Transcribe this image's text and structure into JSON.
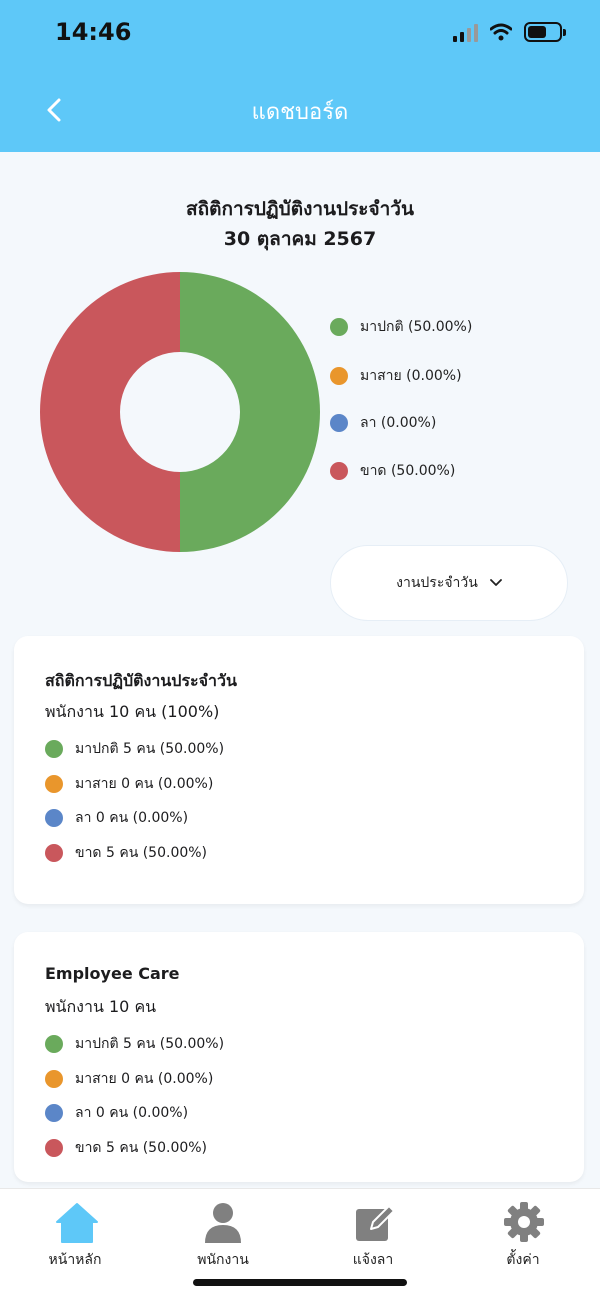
{
  "status_bar": {
    "time": "14:46"
  },
  "header": {
    "title": "แดชบอร์ด",
    "back_icon": "chevron-left-icon"
  },
  "chart_section": {
    "title": "สถิติการปฏิบัติงานประจำวัน",
    "date": "30 ตุลาคม 2567",
    "legend": [
      {
        "label": "มาปกติ (50.00%)",
        "color": "#6aaa5c"
      },
      {
        "label": "มาสาย (0.00%)",
        "color": "#e9962c"
      },
      {
        "label": "ลา (0.00%)",
        "color": "#5b86c8"
      },
      {
        "label": "ขาด (50.00%)",
        "color": "#c9575c"
      }
    ],
    "period_select": {
      "value": "งานประจำวัน",
      "icon": "chevron-down-icon"
    }
  },
  "chart_data": {
    "type": "pie",
    "donut": true,
    "categories": [
      "มาปกติ",
      "มาสาย",
      "ลา",
      "ขาด"
    ],
    "values": [
      50.0,
      0.0,
      0.0,
      50.0
    ],
    "colors": [
      "#6aaa5c",
      "#e9962c",
      "#5b86c8",
      "#c9575c"
    ],
    "legend_position": "right"
  },
  "daily_card": {
    "title": "สถิติการปฏิบัติงานประจำวัน",
    "summary": "พนักงาน 10  คน (100%)",
    "rows": [
      {
        "label": "มาปกติ 5  คน  (50.00%)",
        "color": "#6aaa5c"
      },
      {
        "label": "มาสาย 0  คน  (0.00%)",
        "color": "#e9962c"
      },
      {
        "label": "ลา 0  คน  (0.00%)",
        "color": "#5b86c8"
      },
      {
        "label": "ขาด 5  คน  (50.00%)",
        "color": "#c9575c"
      }
    ]
  },
  "care_card": {
    "title": "Employee Care",
    "summary": "พนักงาน 10  คน",
    "rows": [
      {
        "label": "มาปกติ 5  คน  (50.00%)",
        "color": "#6aaa5c"
      },
      {
        "label": "มาสาย 0  คน  (0.00%)",
        "color": "#e9962c"
      },
      {
        "label": "ลา 0  คน  (0.00%)",
        "color": "#5b86c8"
      },
      {
        "label": "ขาด 5  คน  (50.00%)",
        "color": "#c9575c"
      }
    ]
  },
  "bottom_nav": [
    {
      "label": "หน้าหลัก",
      "icon": "home-icon",
      "active": true
    },
    {
      "label": "พนักงาน",
      "icon": "person-icon",
      "active": false
    },
    {
      "label": "แจ้งลา",
      "icon": "edit-icon",
      "active": false
    },
    {
      "label": "ตั้งค่า",
      "icon": "gear-icon",
      "active": false
    }
  ],
  "theme": {
    "header_bg": "#5ec8f8",
    "active_nav": "#5ec8f8",
    "inactive_nav": "#808080"
  }
}
